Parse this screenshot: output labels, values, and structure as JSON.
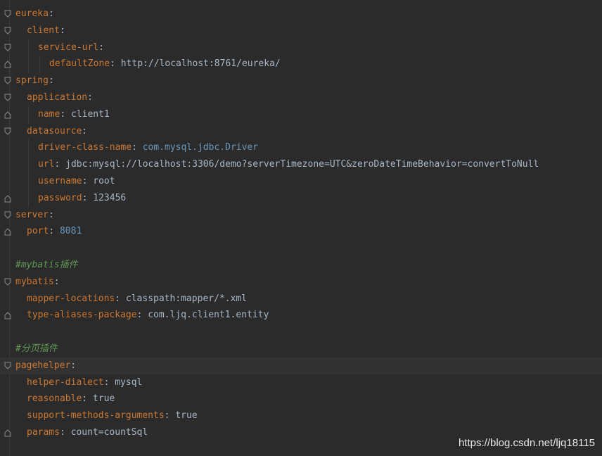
{
  "lines": [
    {
      "key": "eureka",
      "value": ""
    },
    {
      "key": "client",
      "value": ""
    },
    {
      "key": "service-url",
      "value": ""
    },
    {
      "key": "defaultZone",
      "value": "http://localhost:8761/eureka/"
    },
    {
      "key": "spring",
      "value": ""
    },
    {
      "key": "application",
      "value": ""
    },
    {
      "key": "name",
      "value": "client1"
    },
    {
      "key": "datasource",
      "value": ""
    },
    {
      "key": "driver-class-name",
      "value": "com.mysql.jdbc.Driver"
    },
    {
      "key": "url",
      "value": "jdbc:mysql://localhost:3306/demo?serverTimezone=UTC&zeroDateTimeBehavior=convertToNull"
    },
    {
      "key": "username",
      "value": "root"
    },
    {
      "key": "password",
      "value": "123456"
    },
    {
      "key": "server",
      "value": ""
    },
    {
      "key": "port",
      "value": "8081"
    },
    {
      "comment": ""
    },
    {
      "comment": "#mybatis插件"
    },
    {
      "key": "mybatis",
      "value": ""
    },
    {
      "key": "mapper-locations",
      "value": "classpath:mapper/*.xml"
    },
    {
      "key": "type-aliases-package",
      "value": "com.ljq.client1.entity"
    },
    {
      "comment": ""
    },
    {
      "comment": "#分页插件"
    },
    {
      "key": "pagehelper",
      "value": ""
    },
    {
      "key": "helper-dialect",
      "value": "mysql"
    },
    {
      "key": "reasonable",
      "value": "true"
    },
    {
      "key": "support-methods-arguments",
      "value": "true"
    },
    {
      "key": "params",
      "value": "count=countSql"
    }
  ],
  "watermark": "https://blog.csdn.net/ljq18115",
  "colors": {
    "background": "#2b2b2b",
    "key": "#cc7832",
    "text": "#a9b7c6",
    "number": "#6897bb",
    "comment": "#629755"
  }
}
